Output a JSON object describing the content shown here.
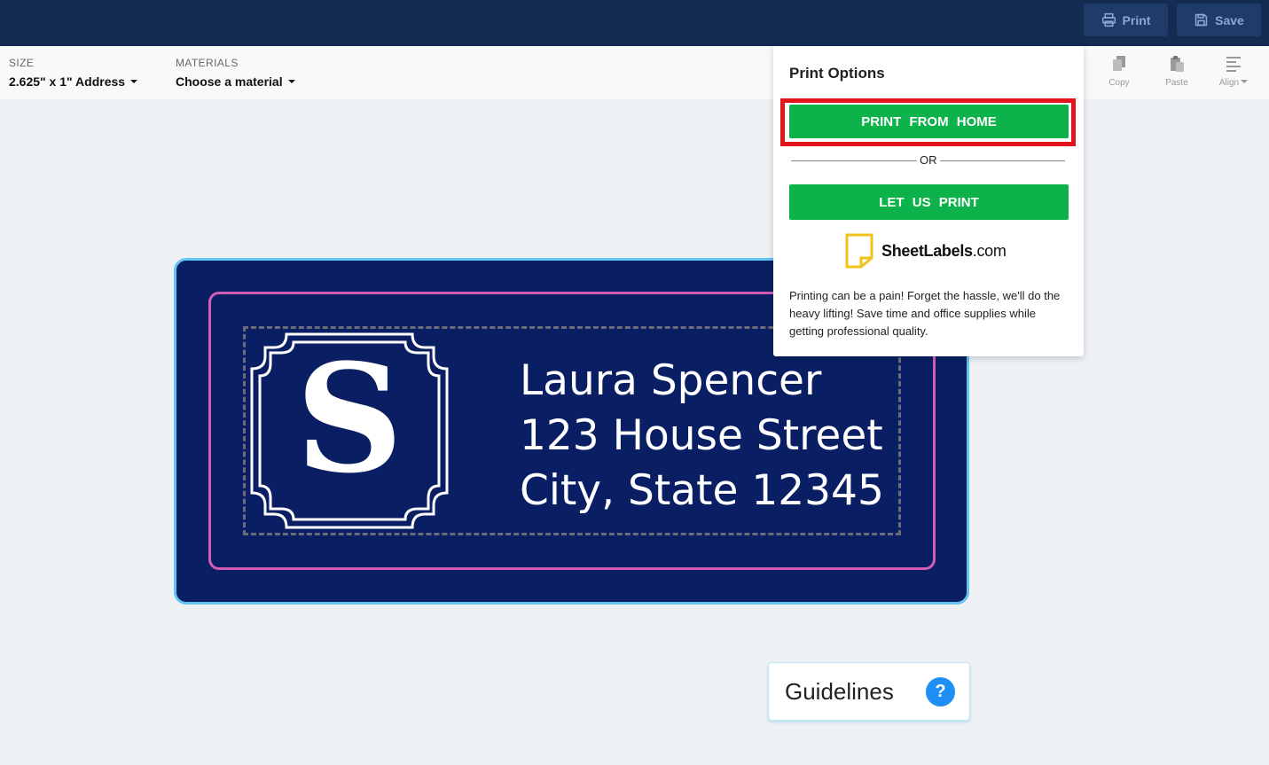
{
  "topbar": {
    "print_label": "Print",
    "save_label": "Save"
  },
  "toolbar": {
    "size_label": "SIZE",
    "size_value": "2.625\" x 1\" Address",
    "materials_label": "MATERIALS",
    "materials_value": "Choose a material",
    "copy_label": "Copy",
    "paste_label": "Paste",
    "align_label": "Align"
  },
  "label": {
    "monogram": "S",
    "line1": "Laura Spencer",
    "line2": "123 House Street",
    "line3": "City, State 12345"
  },
  "guidelines": {
    "label": "Guidelines",
    "help": "?"
  },
  "popup": {
    "title": "Print Options",
    "print_home": "PRINT FROM HOME",
    "or": "OR",
    "let_us_print": "LET US PRINT",
    "brand_name": "SheetLabels",
    "brand_tld": ".com",
    "description": "Printing can be a pain! Forget the hassle, we'll do the heavy lifting! Save time and office supplies while getting professional quality."
  },
  "colors": {
    "topbar": "#142b52",
    "label_bg": "#0a1f63",
    "label_border": "#65c3ef",
    "inner_border": "#d25db6",
    "green": "#0db24a",
    "highlight": "#e3141b"
  },
  "icons": [
    "printer-icon",
    "save-icon",
    "copy-icon",
    "paste-icon",
    "align-icon",
    "help-icon",
    "sheetlabels-logo-icon"
  ]
}
